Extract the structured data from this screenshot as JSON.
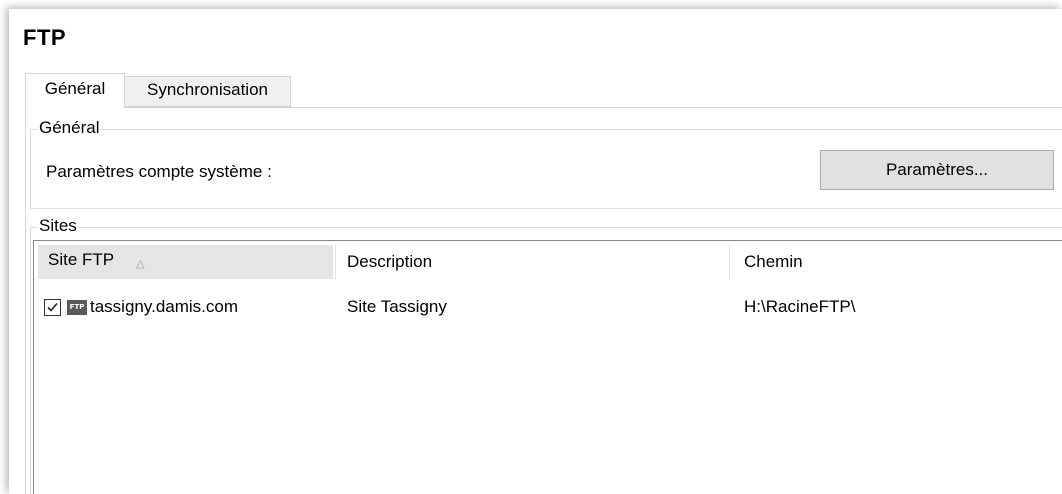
{
  "window": {
    "title": "FTP"
  },
  "tabs": [
    {
      "label": "Général",
      "active": true
    },
    {
      "label": "Synchronisation",
      "active": false
    }
  ],
  "general_group": {
    "legend": "Général",
    "params_label": "Paramètres compte système :",
    "params_button": "Paramètres..."
  },
  "sites_group": {
    "legend": "Sites",
    "columns": [
      "Site FTP",
      "Description",
      "Chemin"
    ],
    "sort_indicator": "△",
    "rows": [
      {
        "checked": true,
        "icon": "ftp-icon",
        "icon_text": "FTP",
        "site": "tassigny.damis.com",
        "description": "Site Tassigny",
        "path": "H:\\RacineFTP\\"
      }
    ]
  }
}
